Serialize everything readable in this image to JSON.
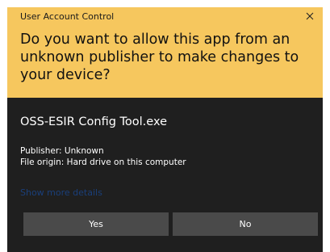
{
  "window": {
    "title": "User Account Control",
    "close_icon": "close-icon"
  },
  "header": {
    "question": "Do you want to allow this app from an unknown publisher to make changes to your device?",
    "background_color": "#f6c75e"
  },
  "app": {
    "name": "OSS-ESIR Config Tool.exe",
    "publisher": "Publisher: Unknown",
    "file_origin": "File origin: Hard drive on this computer"
  },
  "details_link": "Show more details",
  "buttons": {
    "yes": "Yes",
    "no": "No"
  },
  "colors": {
    "dialog_background": "#1f1f1f",
    "button_background": "#4a4a4a",
    "link_color": "#1a3f7a"
  }
}
